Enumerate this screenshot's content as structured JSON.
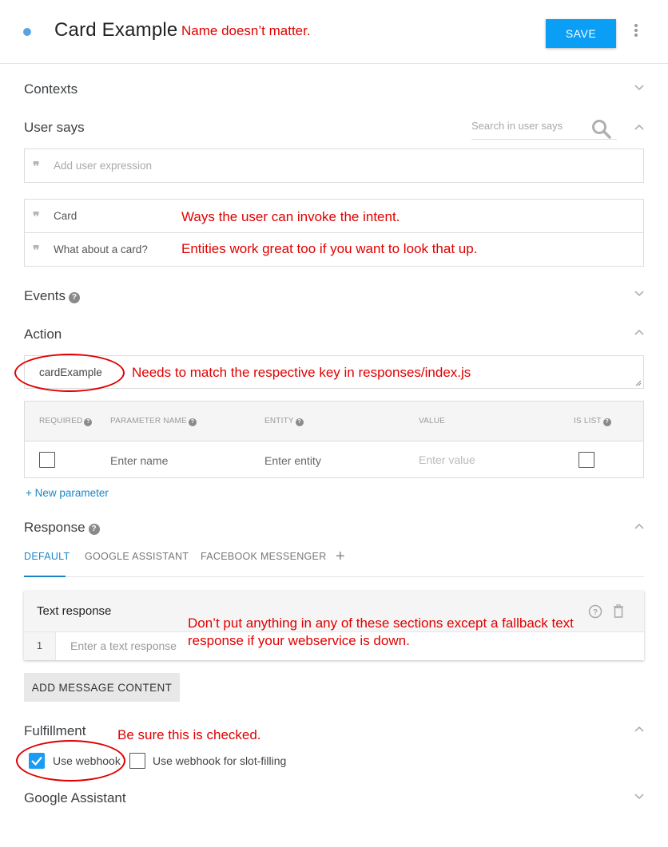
{
  "header": {
    "intent_name": "Card Example",
    "annotation": "Name doesn’t matter.",
    "save_label": "SAVE"
  },
  "sections": {
    "contexts": "Contexts",
    "user_says": "User says",
    "events": "Events",
    "action": "Action",
    "response": "Response",
    "fulfillment": "Fulfillment",
    "google_assistant": "Google Assistant"
  },
  "user_says": {
    "search_placeholder": "Search in user says",
    "add_placeholder": "Add user expression",
    "expressions": [
      "Card",
      "What about a card?"
    ],
    "annotations": [
      "Ways the user can invoke the intent.",
      "Entities work great too if you want to look that up."
    ]
  },
  "action": {
    "value": "cardExample",
    "annotation": "Needs to match the respective key in responses/index.js"
  },
  "parameters": {
    "headers": [
      "REQUIRED",
      "PARAMETER NAME",
      "ENTITY",
      "VALUE",
      "IS LIST"
    ],
    "name_placeholder": "Enter name",
    "entity_placeholder": "Enter entity",
    "value_placeholder": "Enter value",
    "new_parameter": "+ New parameter"
  },
  "response": {
    "tabs": [
      "DEFAULT",
      "GOOGLE ASSISTANT",
      "FACEBOOK MESSENGER"
    ],
    "active_tab": "DEFAULT",
    "card_title": "Text response",
    "row_number": "1",
    "input_placeholder": "Enter a text response",
    "annotation_line1": "Don’t put anything in any of these sections except a fallback text",
    "annotation_line2": "response if your webservice is down.",
    "add_message_label": "ADD MESSAGE CONTENT"
  },
  "fulfillment": {
    "annotation": "Be sure this is checked.",
    "use_webhook_label": "Use webhook",
    "use_webhook_checked": true,
    "slot_filling_label": "Use webhook for slot-filling",
    "slot_filling_checked": false
  },
  "colors": {
    "accent": "#0a9ef4",
    "link": "#1a86c8",
    "annotation": "#e00000"
  }
}
